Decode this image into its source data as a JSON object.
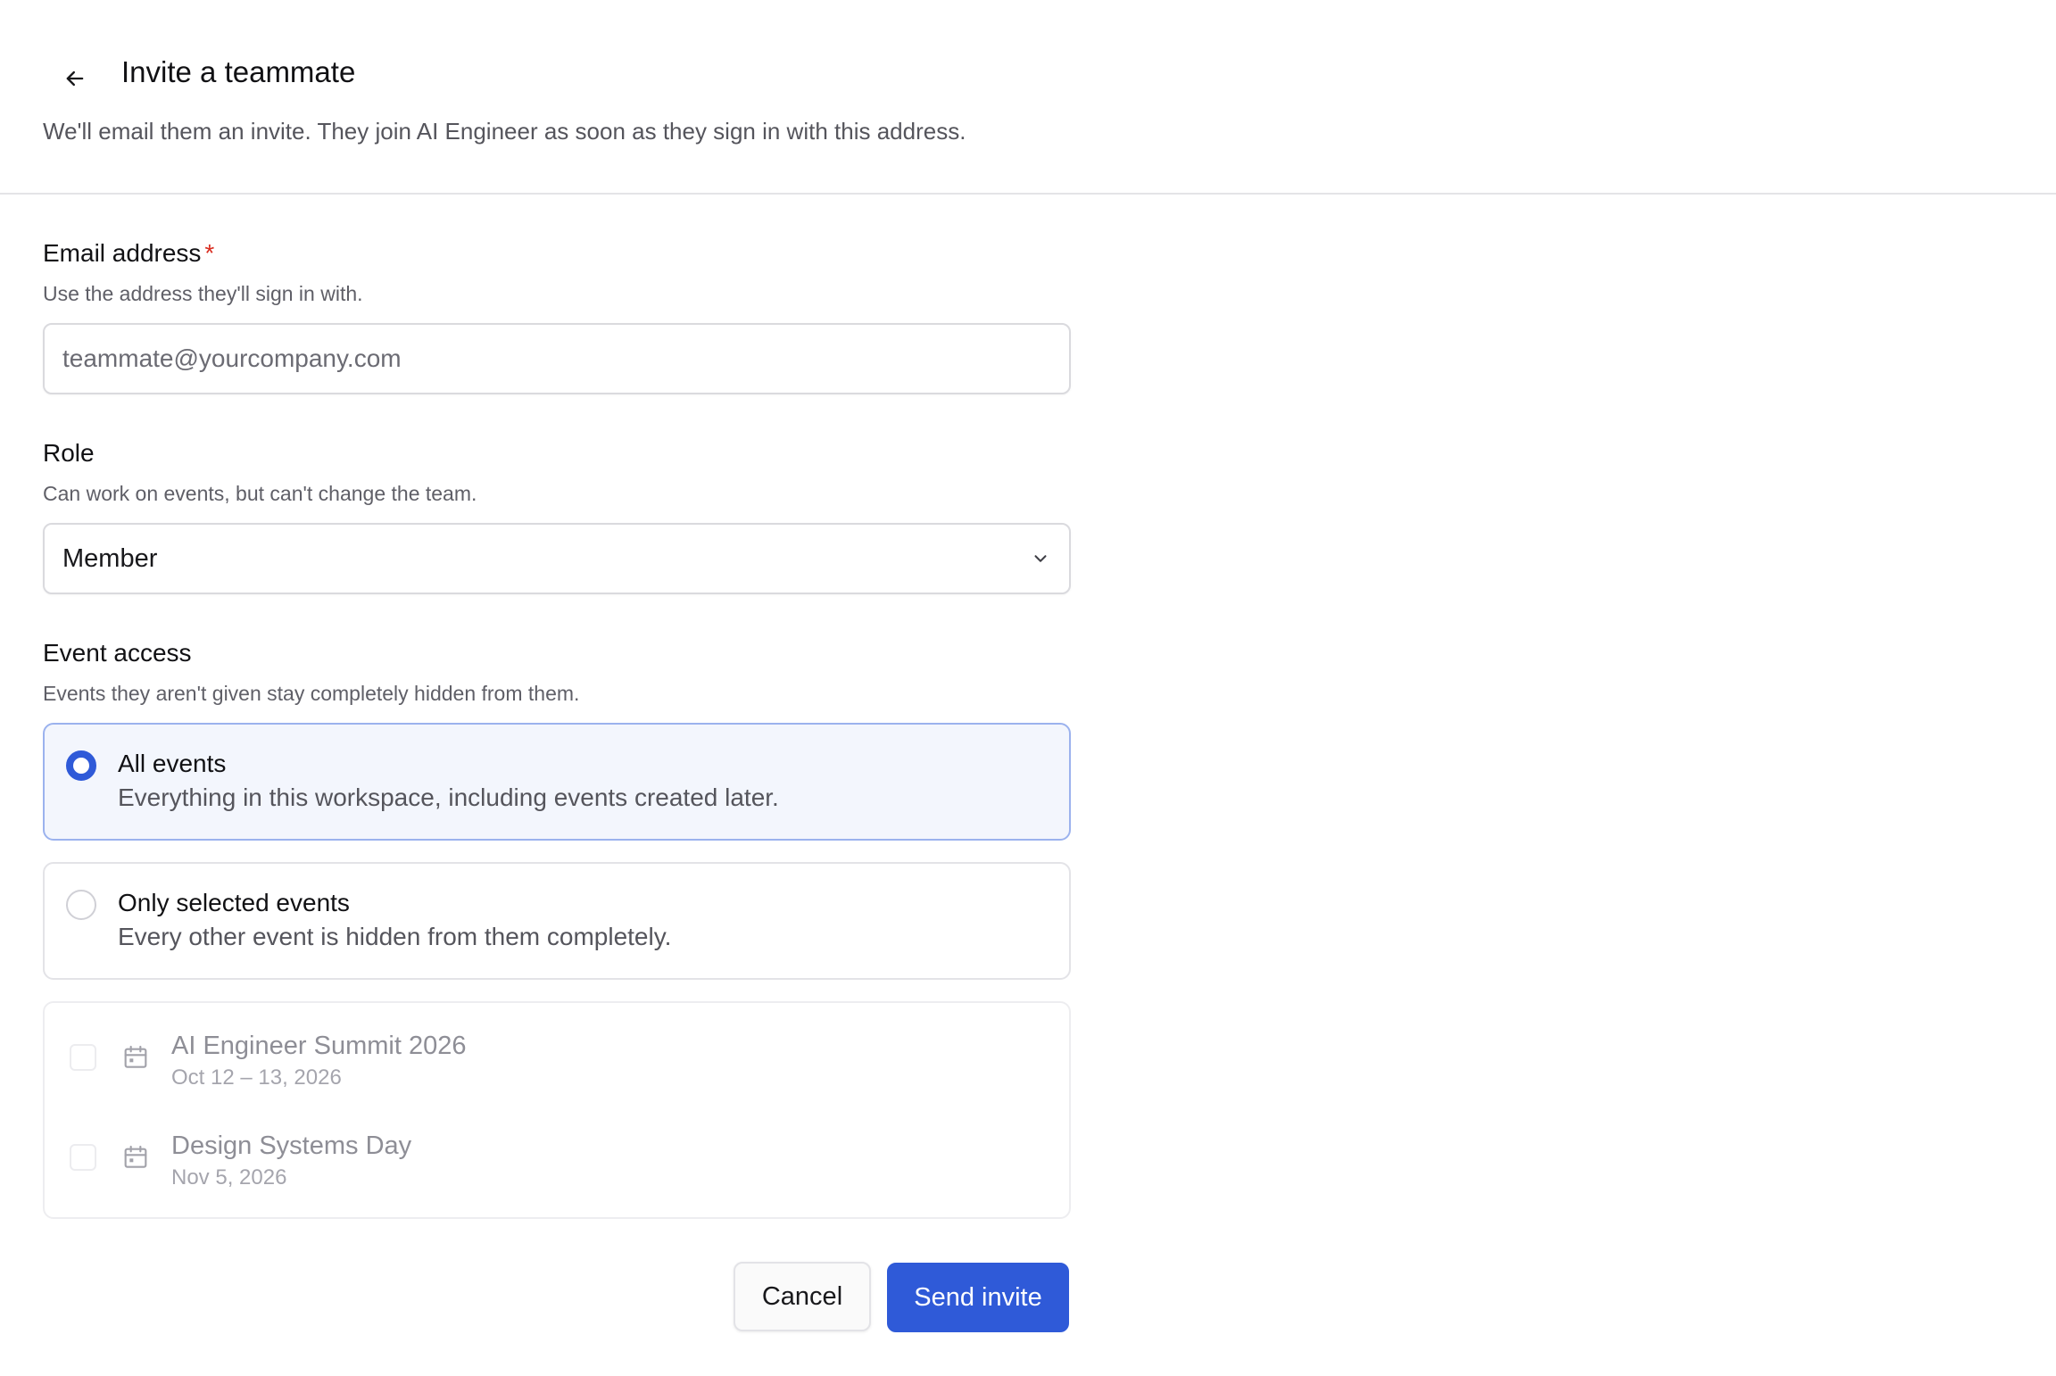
{
  "header": {
    "back_icon": "arrow-left-icon",
    "title": "Invite a teammate",
    "subtitle": "We'll email them an invite. They join AI Engineer as soon as they sign in with this address."
  },
  "email": {
    "label": "Email address",
    "required_mark": "*",
    "hint": "Use the address they'll sign in with.",
    "value": "",
    "placeholder": "teammate@yourcompany.com"
  },
  "role": {
    "label": "Role",
    "hint": "Can work on events, but can't change the team.",
    "selected": "Member",
    "icon": "chevron-down-icon"
  },
  "event_access": {
    "label": "Event access",
    "hint": "Events they aren't given stay completely hidden from them.",
    "options": [
      {
        "title": "All events",
        "description": "Everything in this workspace, including events created later.",
        "selected": true
      },
      {
        "title": "Only selected events",
        "description": "Every other event is hidden from them completely.",
        "selected": false
      }
    ],
    "events": [
      {
        "name": "AI Engineer Summit 2026",
        "date": "Oct 12 – 13, 2026",
        "checked": false,
        "icon": "calendar-icon"
      },
      {
        "name": "Design Systems Day",
        "date": "Nov 5, 2026",
        "checked": false,
        "icon": "calendar-icon"
      }
    ]
  },
  "actions": {
    "cancel_label": "Cancel",
    "send_label": "Send invite"
  },
  "colors": {
    "accent": "#2f5ad8",
    "required": "#d92d20",
    "selected_bg": "#f3f6fd"
  }
}
